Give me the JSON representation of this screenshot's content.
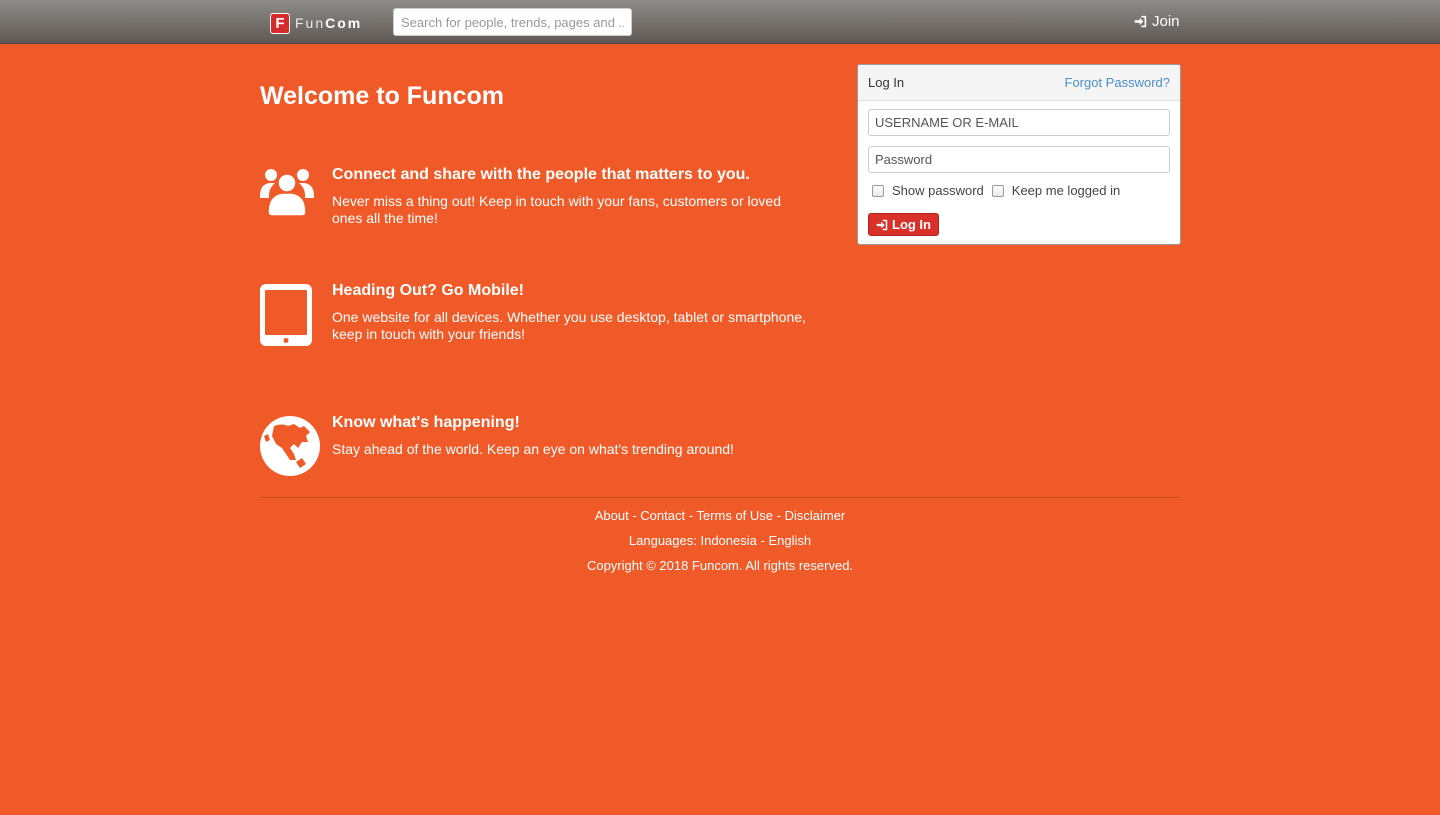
{
  "header": {
    "logo_mark": "F",
    "logo_text_1": "Fun",
    "logo_text_2": "Com",
    "search_placeholder": "Search for people, trends, pages and ...",
    "join_label": "Join"
  },
  "main": {
    "title": "Welcome to Funcom",
    "features": [
      {
        "heading": "Connect and share with the people that matters to you.",
        "text": "Never miss a thing out! Keep in touch with your fans, customers or loved ones all the time!",
        "icon": "users-icon"
      },
      {
        "heading": "Heading Out? Go Mobile!",
        "text": "One website for all devices. Whether you use desktop, tablet or smartphone, keep in touch with your friends!",
        "icon": "tablet-icon"
      },
      {
        "heading": "Know what's happening!",
        "text": "Stay ahead of the world. Keep an eye on what's trending around!",
        "icon": "globe-icon"
      }
    ]
  },
  "login": {
    "title": "Log In",
    "forgot": "Forgot Password?",
    "username_placeholder": "USERNAME OR E-MAIL",
    "password_placeholder": "Password",
    "show_password": "Show password",
    "keep_logged": "Keep me logged in",
    "button": "Log In"
  },
  "footer": {
    "links": [
      "About",
      "Contact",
      "Terms of Use",
      "Disclaimer"
    ],
    "languages_label": "Languages:",
    "languages": [
      "Indonesia",
      "English"
    ],
    "copyright": "Copyright © 2018 Funcom. All rights reserved."
  },
  "colors": {
    "background": "#f05a28",
    "login_button": "#d9302a",
    "link": "#4a90c8"
  }
}
